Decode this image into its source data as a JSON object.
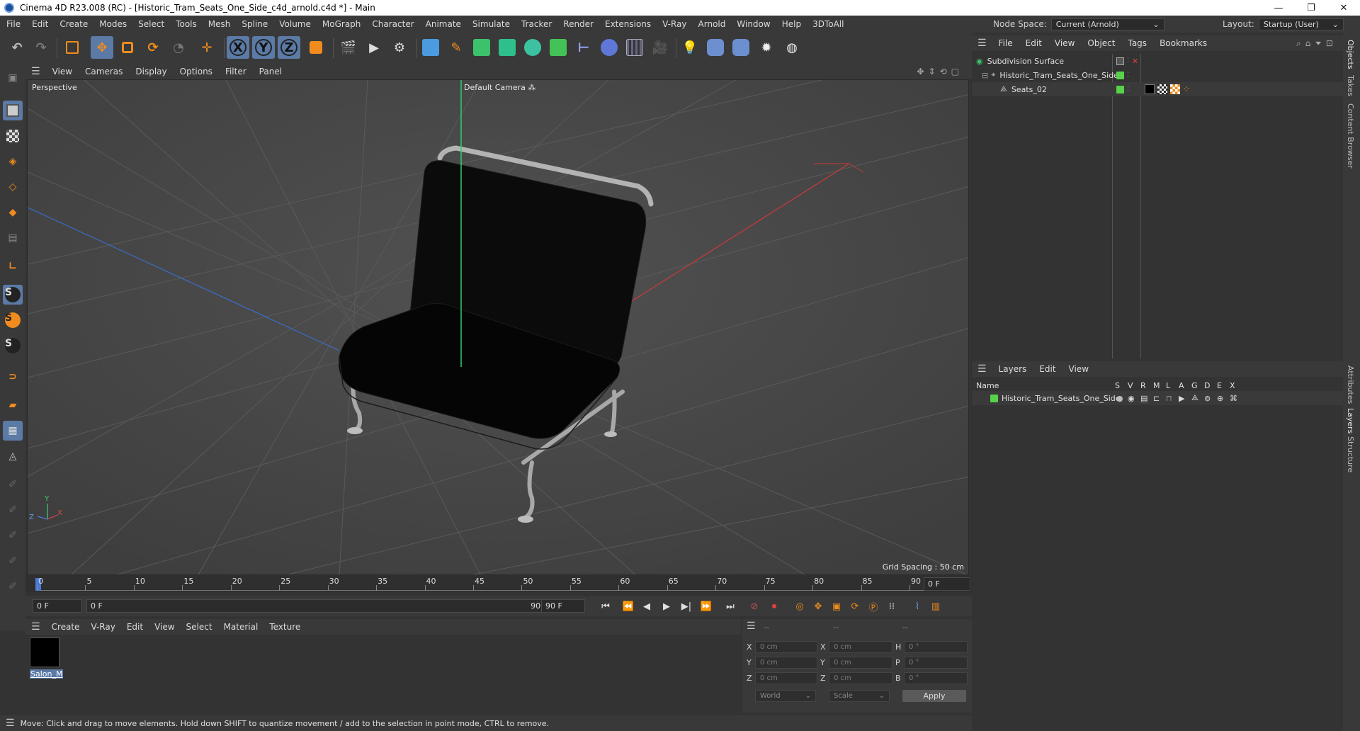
{
  "window": {
    "title": "Cinema 4D R23.008 (RC) - [Historic_Tram_Seats_One_Side_c4d_arnold.c4d *] - Main",
    "minimize": "—",
    "maximize": "❐",
    "close": "✕"
  },
  "menu": [
    "File",
    "Edit",
    "Create",
    "Modes",
    "Select",
    "Tools",
    "Mesh",
    "Spline",
    "Volume",
    "MoGraph",
    "Character",
    "Animate",
    "Simulate",
    "Tracker",
    "Render",
    "Extensions",
    "V-Ray",
    "Arnold",
    "Window",
    "Help",
    "3DToAll"
  ],
  "node_space": {
    "label": "Node Space:",
    "value": "Current (Arnold)"
  },
  "layout": {
    "label": "Layout:",
    "value": "Startup (User)"
  },
  "viewport": {
    "menu": [
      "View",
      "Cameras",
      "Display",
      "Options",
      "Filter",
      "Panel"
    ],
    "view_name": "Perspective",
    "camera": "Default Camera",
    "camera_icon": "⁂",
    "grid_spacing": "Grid Spacing : 50 cm",
    "axis_labels": {
      "x": "X",
      "y": "Y",
      "z": "Z"
    }
  },
  "timeline": {
    "ticks": [
      "0",
      "5",
      "10",
      "15",
      "20",
      "25",
      "30",
      "35",
      "40",
      "45",
      "50",
      "55",
      "60",
      "65",
      "70",
      "75",
      "80",
      "85",
      "90"
    ],
    "current_frame_right": "0 F",
    "start_field": "0 F",
    "range_start": "0 F",
    "range_end": "90 F",
    "end_field": "90 F"
  },
  "material_manager": {
    "menu": [
      "Create",
      "V-Ray",
      "Edit",
      "View",
      "Select",
      "Material",
      "Texture"
    ],
    "materials": [
      {
        "name": "Salon_M",
        "color": "#000000"
      }
    ]
  },
  "coordinates": {
    "headers": [
      "--",
      "--",
      "--"
    ],
    "rows": [
      {
        "l1": "X",
        "v1": "0 cm",
        "l2": "X",
        "v2": "0 cm",
        "l3": "H",
        "v3": "0 °"
      },
      {
        "l1": "Y",
        "v1": "0 cm",
        "l2": "Y",
        "v2": "0 cm",
        "l3": "P",
        "v3": "0 °"
      },
      {
        "l1": "Z",
        "v1": "0 cm",
        "l2": "Z",
        "v2": "0 cm",
        "l3": "B",
        "v3": "0 °"
      }
    ],
    "world_dropdown": "World",
    "scale_dropdown": "Scale",
    "apply": "Apply"
  },
  "object_manager": {
    "menu": [
      "File",
      "Edit",
      "View",
      "Object",
      "Tags",
      "Bookmarks"
    ],
    "objects": [
      {
        "name": "Subdivision Surface",
        "indent": 0,
        "icon": "subdivision-icon"
      },
      {
        "name": "Historic_Tram_Seats_One_Side",
        "indent": 1,
        "icon": "null-icon"
      },
      {
        "name": "Seats_02",
        "indent": 2,
        "icon": "polygon-icon"
      }
    ]
  },
  "layer_manager": {
    "menu": [
      "Layers",
      "Edit",
      "View"
    ],
    "columns": [
      "Name",
      "S",
      "V",
      "R",
      "M",
      "L",
      "A",
      "G",
      "D",
      "E",
      "X"
    ],
    "layers": [
      {
        "name": "Historic_Tram_Seats_One_Side",
        "color": "#57d24a"
      }
    ]
  },
  "side_tabs": [
    "Objects",
    "Takes",
    "Content Browser",
    "Attributes",
    "Layers",
    "Structure"
  ],
  "status": "Move: Click and drag to move elements. Hold down SHIFT to quantize movement / add to the selection in point mode, CTRL to remove.",
  "colors": {
    "accent": "#5b7aa5",
    "orange": "#f08c1e",
    "layer_green": "#57d24a",
    "viewport_bg": "#4a4a4a"
  }
}
